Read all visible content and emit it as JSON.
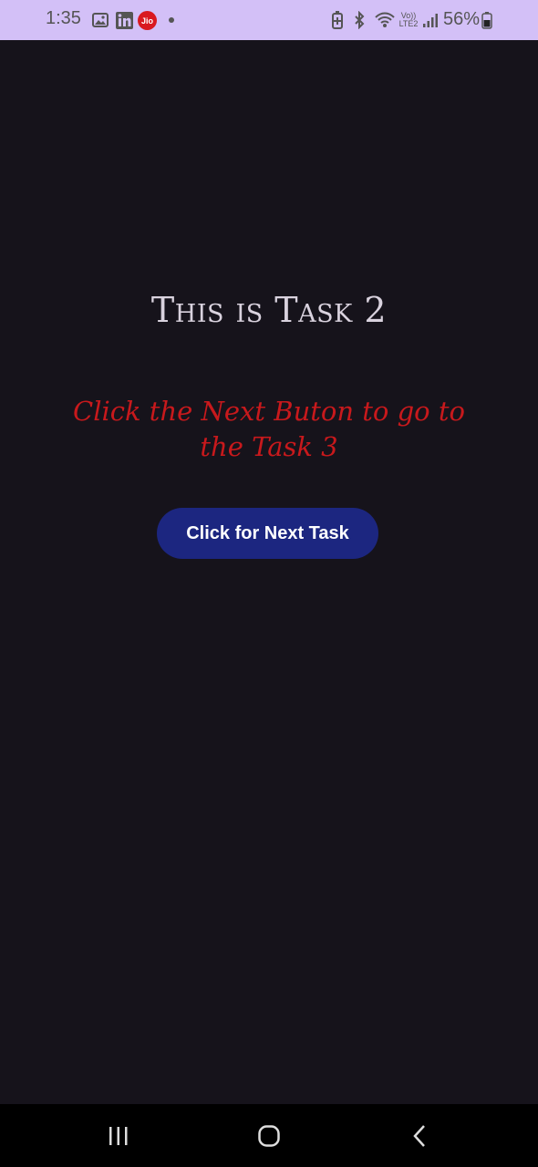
{
  "status_bar": {
    "time": "1:35",
    "battery": "56%",
    "icons": [
      "gallery-icon",
      "linkedin-icon",
      "jio-icon",
      "dot-icon",
      "battery-saver-icon",
      "bluetooth-icon",
      "wifi-icon",
      "volte-icon",
      "signal-icon",
      "battery-icon"
    ],
    "jio_label": "Jio",
    "volte_label": "Vo)) LTE2"
  },
  "main": {
    "title": "This is Task 2",
    "subtitle": "Click the Next Buton to go to the Task 3",
    "next_button_label": "Click for Next Task"
  },
  "nav_bar": {
    "icons": [
      "recents-icon",
      "home-icon",
      "back-icon"
    ]
  },
  "colors": {
    "background": "#16131b",
    "status_bar": "#d3c0f7",
    "title": "#d9d2de",
    "subtitle": "#c8191c",
    "button": "#1c2680"
  }
}
